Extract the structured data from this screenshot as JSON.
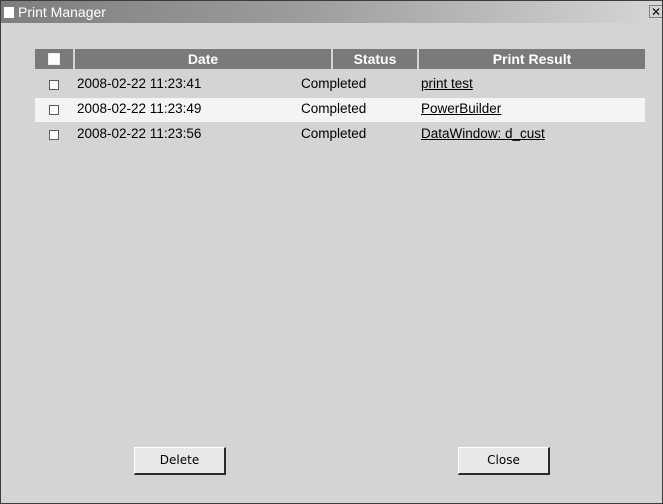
{
  "window": {
    "title": "Print Manager",
    "close_glyph": "✕"
  },
  "table": {
    "columns": [
      "",
      "Date",
      "Status",
      "Print Result"
    ],
    "rows": [
      {
        "checked": false,
        "date": "2008-02-22 11:23:41",
        "status": "Completed",
        "result": "print test"
      },
      {
        "checked": false,
        "date": "2008-02-22 11:23:49",
        "status": "Completed",
        "result": "PowerBuilder"
      },
      {
        "checked": false,
        "date": "2008-02-22 11:23:56",
        "status": "Completed",
        "result": "DataWindow: d_cust"
      }
    ]
  },
  "buttons": {
    "delete_label": "Delete",
    "close_label": "Close"
  },
  "colors": {
    "header_bg": "#7a7a7a",
    "window_bg": "#d4d4d4",
    "selected_row_bg": "#f4f4f4"
  }
}
